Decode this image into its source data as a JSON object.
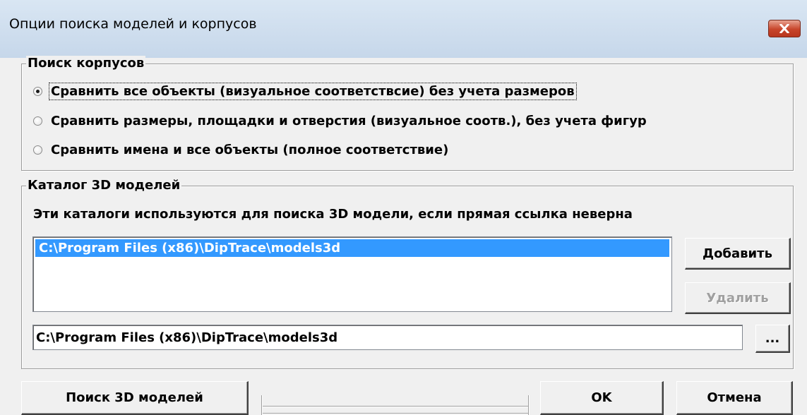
{
  "window": {
    "title": "Опции поиска моделей и корпусов"
  },
  "package_search": {
    "group_title": "Поиск корпусов",
    "options": [
      {
        "label": "Сравнить все объекты (визуальное соответствсие) без учета размеров",
        "checked": true
      },
      {
        "label": "Сравнить размеры, площадки и отверстия (визуальное соотв.), без учета фигур",
        "checked": false
      },
      {
        "label": "Сравнить имена и все объекты (полное соответствие)",
        "checked": false
      }
    ]
  },
  "models_catalog": {
    "group_title": "Каталог 3D моделей",
    "description": "Эти каталоги используются для поиска 3D модели, если прямая ссылка неверна",
    "list_items": [
      "C:\\Program Files (x86)\\DipTrace\\models3d"
    ],
    "add_label": "Добавить",
    "remove_label": "Удалить",
    "path_value": "C:\\Program Files (x86)\\DipTrace\\models3d",
    "browse_label": "..."
  },
  "footer": {
    "search_label": "Поиск 3D моделей",
    "ok_label": "OK",
    "cancel_label": "Отмена"
  }
}
